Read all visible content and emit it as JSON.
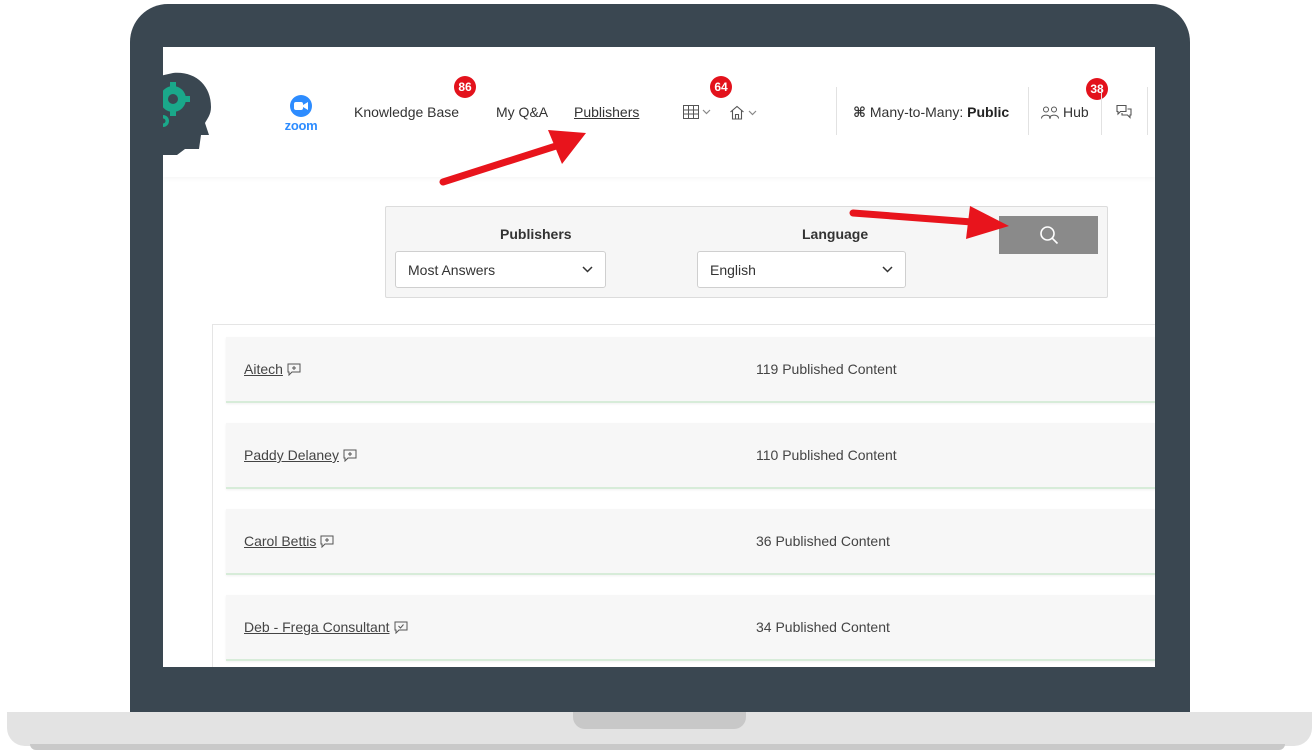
{
  "nav": {
    "knowledge_base": "Knowledge Base",
    "knowledge_base_badge": "86",
    "my_qa": "My Q&A",
    "publishers": "Publishers",
    "grid_badge": "64",
    "zoom_label": "zoom",
    "many_to_many_label": "Many-to-Many:",
    "many_to_many_value": "Public",
    "hub_label": "Hub",
    "hub_badge": "38"
  },
  "filters": {
    "publishers_label": "Publishers",
    "publishers_selected": "Most Answers",
    "language_label": "Language",
    "language_selected": "English"
  },
  "publishers": [
    {
      "name": "Aitech ",
      "count": "119 Published Content"
    },
    {
      "name": "Paddy Delaney ",
      "count": "110 Published Content"
    },
    {
      "name": "Carol Bettis ",
      "count": "36 Published Content"
    },
    {
      "name": "Deb - Frega Consultant ",
      "count": "34 Published Content"
    }
  ],
  "colors": {
    "badge": "#e3121c",
    "frame": "#3a4751",
    "zoom": "#2d8cff",
    "search_button": "#8a8a8a",
    "arrow": "#e8141c"
  },
  "icons": {
    "grid": "grid-icon",
    "home": "home-icon",
    "hub": "people-icon",
    "chat": "chat-icon",
    "search": "search-icon",
    "comment_add": "comment-add-icon",
    "comment_check": "comment-check-icon"
  }
}
